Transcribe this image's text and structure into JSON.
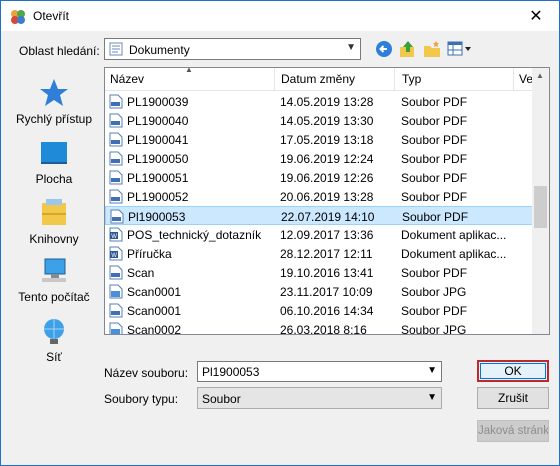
{
  "window": {
    "title": "Otevřít",
    "close_glyph": "✕"
  },
  "toolbar": {
    "lookin_label": "Oblast hledání:",
    "lookin_value": "Dokumenty"
  },
  "places": [
    {
      "label": "Rychlý přístup",
      "icon": "star-icon"
    },
    {
      "label": "Plocha",
      "icon": "desktop-icon"
    },
    {
      "label": "Knihovny",
      "icon": "libraries-icon"
    },
    {
      "label": "Tento počítač",
      "icon": "computer-icon"
    },
    {
      "label": "Síť",
      "icon": "network-icon"
    }
  ],
  "list": {
    "columns": [
      "Název",
      "Datum změny",
      "Typ",
      "Ve"
    ],
    "rows": [
      {
        "name": "PL1900039",
        "date": "14.05.2019 13:28",
        "type": "Soubor PDF",
        "icon": "pdf"
      },
      {
        "name": "PL1900040",
        "date": "14.05.2019 13:30",
        "type": "Soubor PDF",
        "icon": "pdf"
      },
      {
        "name": "PL1900041",
        "date": "17.05.2019 13:18",
        "type": "Soubor PDF",
        "icon": "pdf"
      },
      {
        "name": "PL1900050",
        "date": "19.06.2019 12:24",
        "type": "Soubor PDF",
        "icon": "pdf"
      },
      {
        "name": "PL1900051",
        "date": "19.06.2019 12:26",
        "type": "Soubor PDF",
        "icon": "pdf"
      },
      {
        "name": "PL1900052",
        "date": "20.06.2019 13:28",
        "type": "Soubor PDF",
        "icon": "pdf"
      },
      {
        "name": "Pl1900053",
        "date": "22.07.2019 14:10",
        "type": "Soubor PDF",
        "icon": "pdf",
        "selected": true
      },
      {
        "name": "POS_technický_dotazník",
        "date": "12.09.2017 13:36",
        "type": "Dokument aplikac...",
        "icon": "word"
      },
      {
        "name": "Příručka",
        "date": "28.12.2017 12:11",
        "type": "Dokument aplikac...",
        "icon": "word"
      },
      {
        "name": "Scan",
        "date": "19.10.2016 13:41",
        "type": "Soubor PDF",
        "icon": "pdf"
      },
      {
        "name": "Scan0001",
        "date": "23.11.2017 10:09",
        "type": "Soubor JPG",
        "icon": "jpg"
      },
      {
        "name": "Scan0001",
        "date": "06.10.2016 14:34",
        "type": "Soubor PDF",
        "icon": "pdf"
      },
      {
        "name": "Scan0002",
        "date": "26.03.2018 8:16",
        "type": "Soubor JPG",
        "icon": "jpg"
      }
    ]
  },
  "footer": {
    "filename_label": "Název souboru:",
    "filename_value": "Pl1900053",
    "filetype_label": "Soubory typu:",
    "filetype_value": "Soubor",
    "ok_label": "OK",
    "cancel_label": "Zrušit",
    "extra_label": "Jaková stránka"
  }
}
